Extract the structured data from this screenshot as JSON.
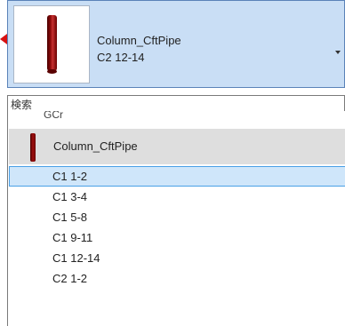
{
  "selector": {
    "name": "Column_CftPipe",
    "size": "C2 12-14"
  },
  "search": {
    "placeholder": "検索"
  },
  "list": {
    "cut_top_text": "GCr",
    "group_label": "Column_CftPipe",
    "items": [
      "C1 1-2",
      "C1 3-4",
      "C1 5-8",
      "C1 9-11",
      "C1 12-14",
      "C2 1-2"
    ],
    "selected_index": 0
  },
  "colors": {
    "selector_bg": "#c9def5",
    "selected_bg": "#cfe6fa",
    "selected_border": "#4aa0e6",
    "pipe": "#8e0a0a"
  }
}
